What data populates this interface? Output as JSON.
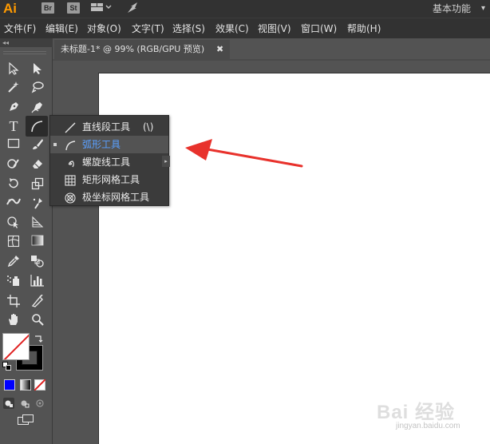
{
  "app": {
    "logo": "Ai",
    "br_label": "Br",
    "st_label": "St",
    "workspace": "基本功能",
    "brand_color": "#ff9a00"
  },
  "menu": {
    "items": [
      "文件(F)",
      "编辑(E)",
      "对象(O)",
      "文字(T)",
      "选择(S)",
      "效果(C)",
      "视图(V)",
      "窗口(W)",
      "帮助(H)"
    ]
  },
  "document": {
    "tab_title": "未标题-1* @ 99% (RGB/GPU 预览)",
    "close_glyph": "✖"
  },
  "toolbar": {
    "collapse_glyph": "◂◂",
    "tools": [
      "selection-tool",
      "direct-selection-tool",
      "magic-wand-tool",
      "lasso-tool",
      "pen-tool",
      "curvature-tool",
      "type-tool",
      "arc-tool",
      "rectangle-tool",
      "paintbrush-tool",
      "shaper-tool",
      "eraser-tool",
      "rotate-tool",
      "scale-tool",
      "width-tool",
      "puppet-warp-tool",
      "shape-builder-tool",
      "perspective-grid-tool",
      "mesh-tool",
      "gradient-tool",
      "eyedropper-tool",
      "blend-tool",
      "symbol-sprayer-tool",
      "column-graph-tool",
      "artboard-tool",
      "slice-tool",
      "hand-tool",
      "zoom-tool"
    ],
    "type_tool_glyph": "T"
  },
  "flyout": {
    "items": [
      {
        "label": "直线段工具",
        "shortcut": "(\\)",
        "icon": "line-segment-icon"
      },
      {
        "label": "弧形工具",
        "shortcut": "",
        "icon": "arc-icon"
      },
      {
        "label": "螺旋线工具",
        "shortcut": "",
        "icon": "spiral-icon"
      },
      {
        "label": "矩形网格工具",
        "shortcut": "",
        "icon": "rectangular-grid-icon"
      },
      {
        "label": "极坐标网格工具",
        "shortcut": "",
        "icon": "polar-grid-icon"
      }
    ],
    "highlight_color": "#5aa0ff"
  },
  "annotation": {
    "arrow_color": "#e8322c"
  },
  "watermark": {
    "text": "Bai 经验",
    "sub": "jingyan.baidu.com"
  }
}
